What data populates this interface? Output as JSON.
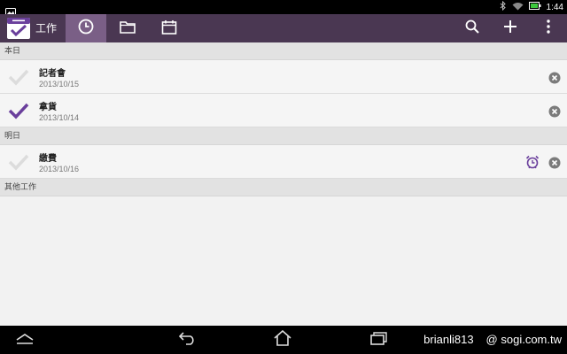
{
  "status_bar": {
    "time": "1:44",
    "icons": [
      "notification-icon",
      "bluetooth-icon",
      "wifi-icon",
      "battery-icon"
    ]
  },
  "action_bar": {
    "app_title": "工作",
    "tabs": [
      {
        "icon": "clock-icon",
        "active": true
      },
      {
        "icon": "folder-icon",
        "active": false
      },
      {
        "icon": "calendar-icon",
        "active": false
      }
    ],
    "actions": [
      "search-icon",
      "plus-icon",
      "overflow-menu-icon"
    ],
    "colors": {
      "bar": "#4a3752",
      "active_tab": "#7a5f86",
      "accent": "#6a3f9c"
    }
  },
  "sections": [
    {
      "header": "本日",
      "tasks": [
        {
          "title": "記者會",
          "date": "2013/10/15",
          "done": false,
          "alarm": false
        },
        {
          "title": "拿貨",
          "date": "2013/10/14",
          "done": true,
          "alarm": false
        }
      ]
    },
    {
      "header": "明日",
      "tasks": [
        {
          "title": "繳費",
          "date": "2013/10/16",
          "done": false,
          "alarm": true
        }
      ]
    },
    {
      "header": "其他工作",
      "tasks": []
    }
  ],
  "nav_bar": {
    "buttons": [
      "chevron-up-icon",
      "back-icon",
      "home-icon",
      "recent-apps-icon"
    ]
  },
  "watermark": {
    "author": "brianli813",
    "site": "@ sogi.com.tw"
  }
}
